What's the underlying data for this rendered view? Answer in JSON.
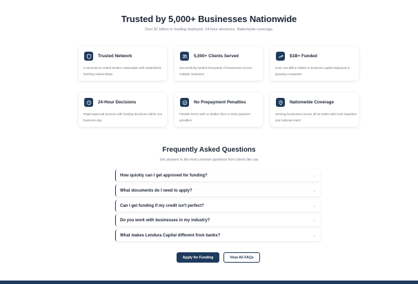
{
  "hero": {
    "title": "Trusted by 5,000+ Businesses Nationwide",
    "subtitle": "Over $1 billion in funding deployed. 24-hour decisions. Nationwide coverage."
  },
  "features": [
    {
      "icon": "shield-icon",
      "title": "Trusted Network",
      "desc": "Connected to vetted lenders nationwide with established banking relationships"
    },
    {
      "icon": "users-icon",
      "title": "5,000+ Clients Served",
      "desc": "Successfully funded thousands of businesses across multiple industries"
    },
    {
      "icon": "trend-up-icon",
      "title": "$1B+ Funded",
      "desc": "Over one billion dollars in business capital deployed to growing companies"
    },
    {
      "icon": "clock-icon",
      "title": "24-Hour Decisions",
      "desc": "Rapid approval process with funding decisions within one business day"
    },
    {
      "icon": "check-circle-icon",
      "title": "No Prepayment Penalties",
      "desc": "Flexible terms with no hidden fees or early payment penalties"
    },
    {
      "icon": "location-pin-icon",
      "title": "Nationwide Coverage",
      "desc": "Serving businesses across all 50 states with local expertise and national reach"
    }
  ],
  "faq": {
    "title": "Frequently Asked Questions",
    "subtitle": "Get answers to the most common questions from clients like you",
    "items": [
      {
        "question": "How quickly can I get approved for funding?"
      },
      {
        "question": "What documents do I need to apply?"
      },
      {
        "question": "Can I get funding if my credit isn't perfect?"
      },
      {
        "question": "Do you work with businesses in my industry?"
      },
      {
        "question": "What makes Lendura Capital different from banks?"
      }
    ]
  },
  "buttons": {
    "apply": "Apply for Funding",
    "view_all": "View All FAQs"
  },
  "colors": {
    "brand_navy": "#1e3a5c",
    "text_dark": "#1c2434",
    "text_muted": "#7a8290"
  }
}
